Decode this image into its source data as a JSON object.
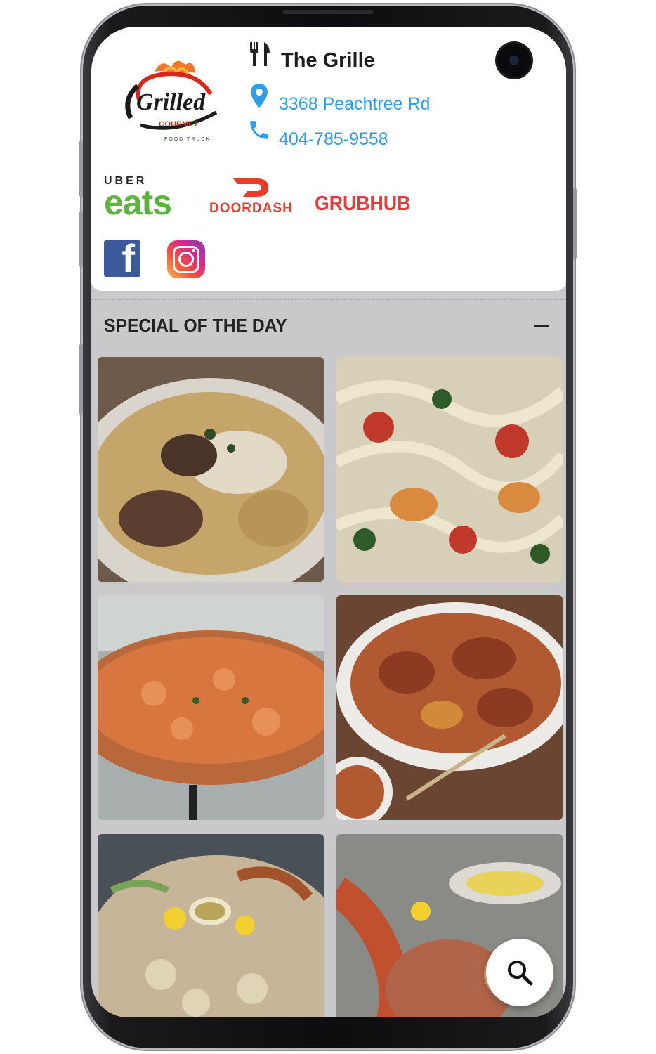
{
  "restaurant": {
    "name": "The Grille",
    "address": "3368 Peachtree Rd",
    "phone": "404-785-9558"
  },
  "logo": {
    "text": "Grilled",
    "subtext": "GOURMET",
    "tagline": "FOOD TRUCK"
  },
  "delivery": {
    "ubereats_top": "UBER",
    "ubereats_bottom": "eats",
    "doordash": "DOORDASH",
    "grubhub": "GRUBHUB"
  },
  "social": {
    "facebook_icon": "facebook-icon",
    "instagram_icon": "instagram-icon"
  },
  "section": {
    "title": "SPECIAL OF THE DAY"
  },
  "dishes": [
    {
      "icon": "pasta-with-beef-image"
    },
    {
      "icon": "shrimp-linguine-image"
    },
    {
      "icon": "seafood-pizza-image"
    },
    {
      "icon": "chicken-peppers-platter-image"
    },
    {
      "icon": "grilled-seafood-platter-image"
    },
    {
      "icon": "lobster-seafood-image"
    }
  ],
  "colors": {
    "link": "#2f9ee6",
    "ubereats": "#5bb53a",
    "doordash": "#ea3b2a",
    "grubhub": "#e23c3c",
    "facebook": "#3b5a9a"
  }
}
